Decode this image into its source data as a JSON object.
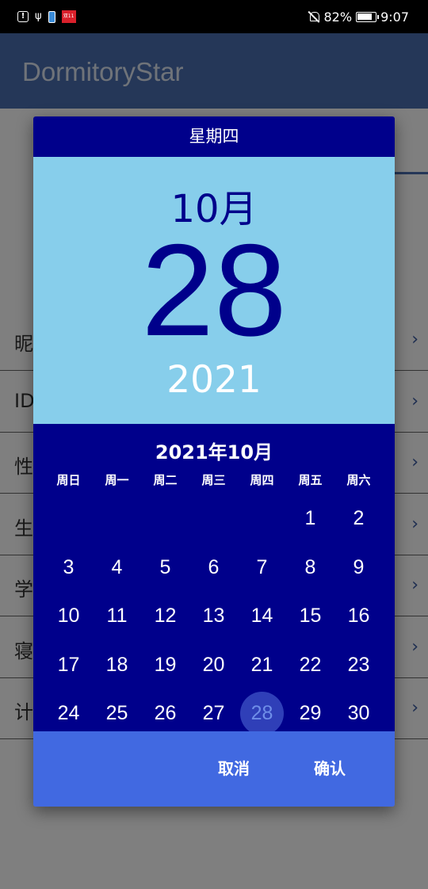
{
  "status_bar": {
    "battery_percent": "82%",
    "time": "9:07",
    "left_icons": [
      "alert-icon",
      "usb-icon",
      "battery-saver-icon",
      "app-notification-icon"
    ],
    "app_icon_text": "双11"
  },
  "app": {
    "title": "DormitoryStar"
  },
  "form": {
    "rows": [
      {
        "label": "昵"
      },
      {
        "label": "ID"
      },
      {
        "label": "性"
      },
      {
        "label": "生"
      },
      {
        "label": "学"
      },
      {
        "label": "寝"
      },
      {
        "label": "计"
      }
    ]
  },
  "date_picker": {
    "weekday": "星期四",
    "month": "10月",
    "day": "28",
    "year": "2021",
    "calendar_title": "2021年10月",
    "weekday_headers": [
      "周日",
      "周一",
      "周二",
      "周三",
      "周四",
      "周五",
      "周六"
    ],
    "days": [
      "",
      "",
      "",
      "",
      "",
      "1",
      "2",
      "3",
      "4",
      "5",
      "6",
      "7",
      "8",
      "9",
      "10",
      "11",
      "12",
      "13",
      "14",
      "15",
      "16",
      "17",
      "18",
      "19",
      "20",
      "21",
      "22",
      "23",
      "24",
      "25",
      "26",
      "27",
      "28",
      "29",
      "30"
    ],
    "selected_day": "28",
    "cancel_label": "取消",
    "confirm_label": "确认",
    "colors": {
      "header_bg": "#00008b",
      "date_panel_bg": "#87ceeb",
      "actions_bg": "#4169e1"
    }
  }
}
